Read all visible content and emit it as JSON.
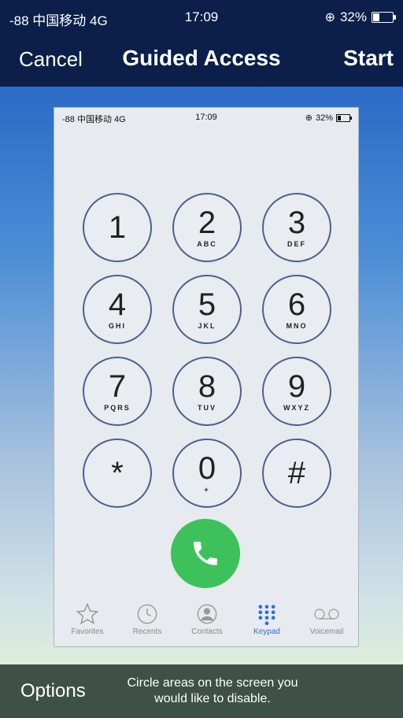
{
  "status": {
    "carrier": "-88 中国移动  4G",
    "time": "17:09",
    "battery": "32%",
    "battery_level": 0.32
  },
  "nav": {
    "cancel": "Cancel",
    "title": "Guided Access",
    "start": "Start"
  },
  "preview": {
    "status": {
      "carrier": "-88 中国移动  4G",
      "time": "17:09",
      "battery": "32%"
    },
    "keypad": [
      {
        "digit": "1",
        "letters": ""
      },
      {
        "digit": "2",
        "letters": "ABC"
      },
      {
        "digit": "3",
        "letters": "DEF"
      },
      {
        "digit": "4",
        "letters": "GHI"
      },
      {
        "digit": "5",
        "letters": "JKL"
      },
      {
        "digit": "6",
        "letters": "MNO"
      },
      {
        "digit": "7",
        "letters": "PQRS"
      },
      {
        "digit": "8",
        "letters": "TUV"
      },
      {
        "digit": "9",
        "letters": "WXYZ"
      },
      {
        "digit": "*",
        "letters": ""
      },
      {
        "digit": "0",
        "letters": "+"
      },
      {
        "digit": "#",
        "letters": ""
      }
    ],
    "tabs": [
      {
        "label": "Favorites",
        "icon": "star-icon"
      },
      {
        "label": "Recents",
        "icon": "clock-icon"
      },
      {
        "label": "Contacts",
        "icon": "contacts-icon"
      },
      {
        "label": "Keypad",
        "icon": "keypad-icon",
        "active": true
      },
      {
        "label": "Voicemail",
        "icon": "voicemail-icon"
      }
    ],
    "call_icon": "phone-icon"
  },
  "bottom": {
    "options": "Options",
    "hint": "Circle areas on the screen you would like to disable."
  },
  "colors": {
    "nav_bg": "#0b1f4a",
    "bottom_bg": "#3f5047",
    "call_green": "#3dc15a",
    "active_tab": "#2b6fe0"
  }
}
